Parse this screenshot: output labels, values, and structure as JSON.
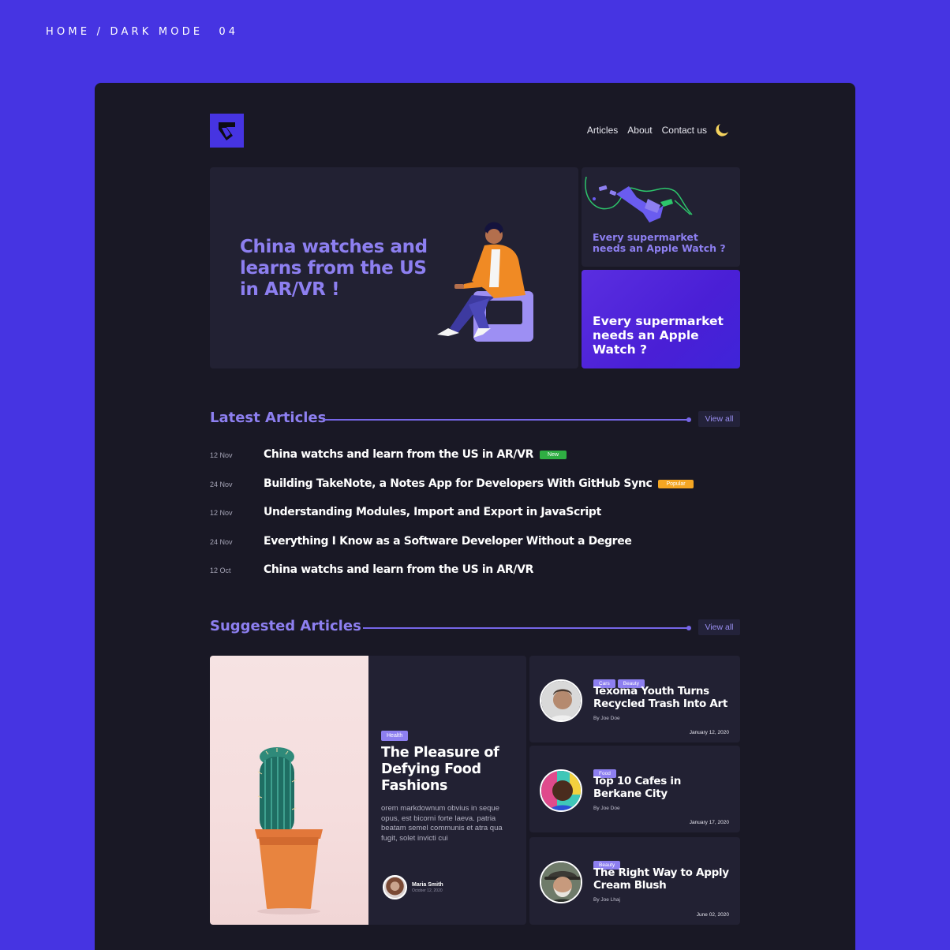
{
  "caption": {
    "text": "HOME / DARK MODE",
    "number": "04"
  },
  "nav": {
    "items": [
      "Articles",
      "About",
      "Contact us"
    ],
    "theme_icon": "moon-icon"
  },
  "hero": {
    "title": "China watches and learns from the US in AR/VR !",
    "side_top_title": "Every supermarket needs an Apple Watch ?",
    "side_bottom_title": "Every supermarket needs an Apple Watch ?"
  },
  "latest": {
    "heading": "Latest Articles",
    "view_all": "View all",
    "articles": [
      {
        "date": "12 Nov",
        "title": "China watchs and learn from the US in AR/VR",
        "badge": "New",
        "badge_color": "#2fae43"
      },
      {
        "date": "24 Nov",
        "title": "Building TakeNote, a Notes App for Developers With GitHub Sync",
        "badge": "Popular",
        "badge_color": "#f5a623"
      },
      {
        "date": "12 Nov",
        "title": "Understanding Modules, Import and Export in JavaScript",
        "badge": "",
        "badge_color": ""
      },
      {
        "date": "24 Nov",
        "title": "Everything I Know as a Software Developer Without a Degree",
        "badge": "",
        "badge_color": ""
      },
      {
        "date": "12 Oct",
        "title": "China watchs and learn from the US in AR/VR",
        "badge": "",
        "badge_color": ""
      }
    ]
  },
  "suggested": {
    "heading": "Suggested Articles",
    "view_all": "View all",
    "featured": {
      "tag": "Health",
      "title": "The Pleasure of Defying Food Fashions",
      "excerpt": "orem markdownum obvius in seque opus, est bicorni forte laeva. patria beatam semel communis et atra qua fugit, solet invicti cui",
      "author": "Maria Smith",
      "date": "October 12, 2020"
    },
    "cards": [
      {
        "tags": [
          "Cars",
          "Beauty"
        ],
        "title": "Texoma Youth Turns Recycled Trash Into Art",
        "by": "By Joe Doe",
        "date": "January 12, 2020"
      },
      {
        "tags": [
          "Food"
        ],
        "title": "Top 10 Cafes in Berkane City",
        "by": "By Joe Doe",
        "date": "January 17, 2020"
      },
      {
        "tags": [
          "Beauty"
        ],
        "title": "The Right Way to Apply Cream Blush",
        "by": "By Joe Lhaj",
        "date": "June 02, 2020"
      }
    ]
  },
  "colors": {
    "background": "#4634e2",
    "panel": "#191825",
    "card": "#222133",
    "accent": "#8d7ff0"
  }
}
